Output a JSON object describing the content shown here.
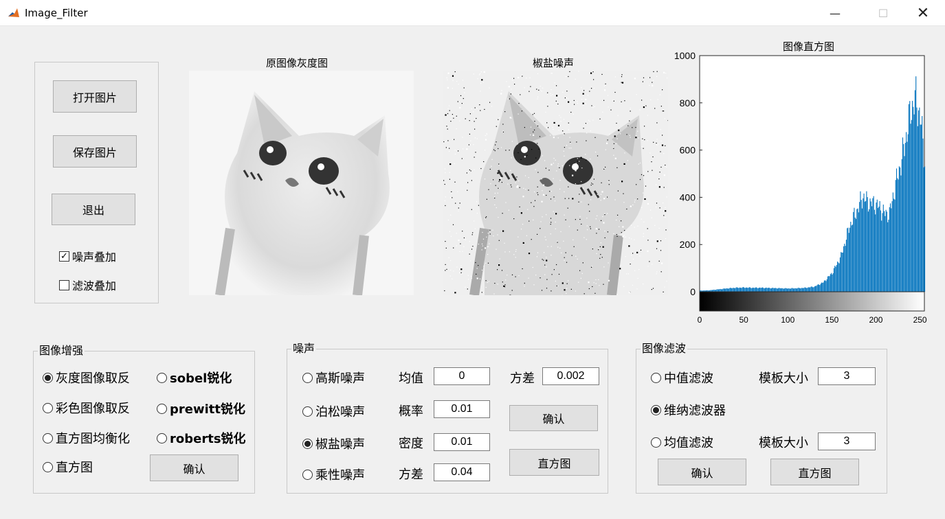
{
  "window": {
    "title": "Image_Filter",
    "min": "—",
    "max": "☐",
    "close": "✕"
  },
  "control_panel": {
    "open_btn": "打开图片",
    "save_btn": "保存图片",
    "exit_btn": "退出",
    "noise_overlay": {
      "label": "噪声叠加",
      "checked": true
    },
    "filter_overlay": {
      "label": "滤波叠加",
      "checked": false
    }
  },
  "axes": {
    "original_title": "原图像灰度图",
    "noisy_title": "椒盐噪声",
    "hist_title": "图像直方图"
  },
  "enhance": {
    "title": "图像增强",
    "gray_invert": "灰度图像取反",
    "sobel": "sobel锐化",
    "color_invert": "彩色图像取反",
    "prewitt": "prewitt锐化",
    "hist_eq": "直方图均衡化",
    "roberts": "roberts锐化",
    "histogram": "直方图",
    "confirm": "确认",
    "selected": "gray_invert"
  },
  "noise": {
    "title": "噪声",
    "gaussian": "高斯噪声",
    "mean_label": "均值",
    "mean_value": "0",
    "variance_label": "方差",
    "variance_value": "0.002",
    "poisson": "泊松噪声",
    "prob_label": "概率",
    "prob_value": "0.01",
    "salt_pepper": "椒盐噪声",
    "density_label": "密度",
    "density_value": "0.01",
    "multiplicative": "乘性噪声",
    "mult_var_label": "方差",
    "mult_var_value": "0.04",
    "confirm": "确认",
    "histogram": "直方图",
    "selected": "salt_pepper"
  },
  "filter": {
    "title": "图像滤波",
    "median": "中值滤波",
    "median_size_label": "模板大小",
    "median_size": "3",
    "wiener": "维纳滤波器",
    "mean": "均值滤波",
    "mean_size_label": "模板大小",
    "mean_size": "3",
    "confirm": "确认",
    "histogram": "直方图",
    "selected": "wiener"
  },
  "chart_data": {
    "type": "bar",
    "title": "图像直方图",
    "xlim": [
      0,
      255
    ],
    "ylim": [
      0,
      1000
    ],
    "xticks": [
      "0",
      "50",
      "100",
      "150",
      "200",
      "250"
    ],
    "yticks": [
      "0",
      "200",
      "400",
      "600",
      "800",
      "1000"
    ],
    "bar_color": "#0072bd",
    "colorbar": "gray",
    "profile": [
      [
        0,
        5
      ],
      [
        10,
        6
      ],
      [
        20,
        10
      ],
      [
        30,
        14
      ],
      [
        40,
        17
      ],
      [
        50,
        18
      ],
      [
        60,
        17
      ],
      [
        70,
        17
      ],
      [
        80,
        16
      ],
      [
        90,
        15
      ],
      [
        100,
        14
      ],
      [
        110,
        15
      ],
      [
        120,
        17
      ],
      [
        130,
        22
      ],
      [
        140,
        40
      ],
      [
        150,
        80
      ],
      [
        160,
        150
      ],
      [
        170,
        280
      ],
      [
        180,
        360
      ],
      [
        185,
        405
      ],
      [
        190,
        380
      ],
      [
        200,
        370
      ],
      [
        210,
        330
      ],
      [
        215,
        330
      ],
      [
        220,
        420
      ],
      [
        230,
        580
      ],
      [
        240,
        780
      ],
      [
        245,
        815
      ],
      [
        250,
        740
      ],
      [
        255,
        560
      ]
    ]
  }
}
